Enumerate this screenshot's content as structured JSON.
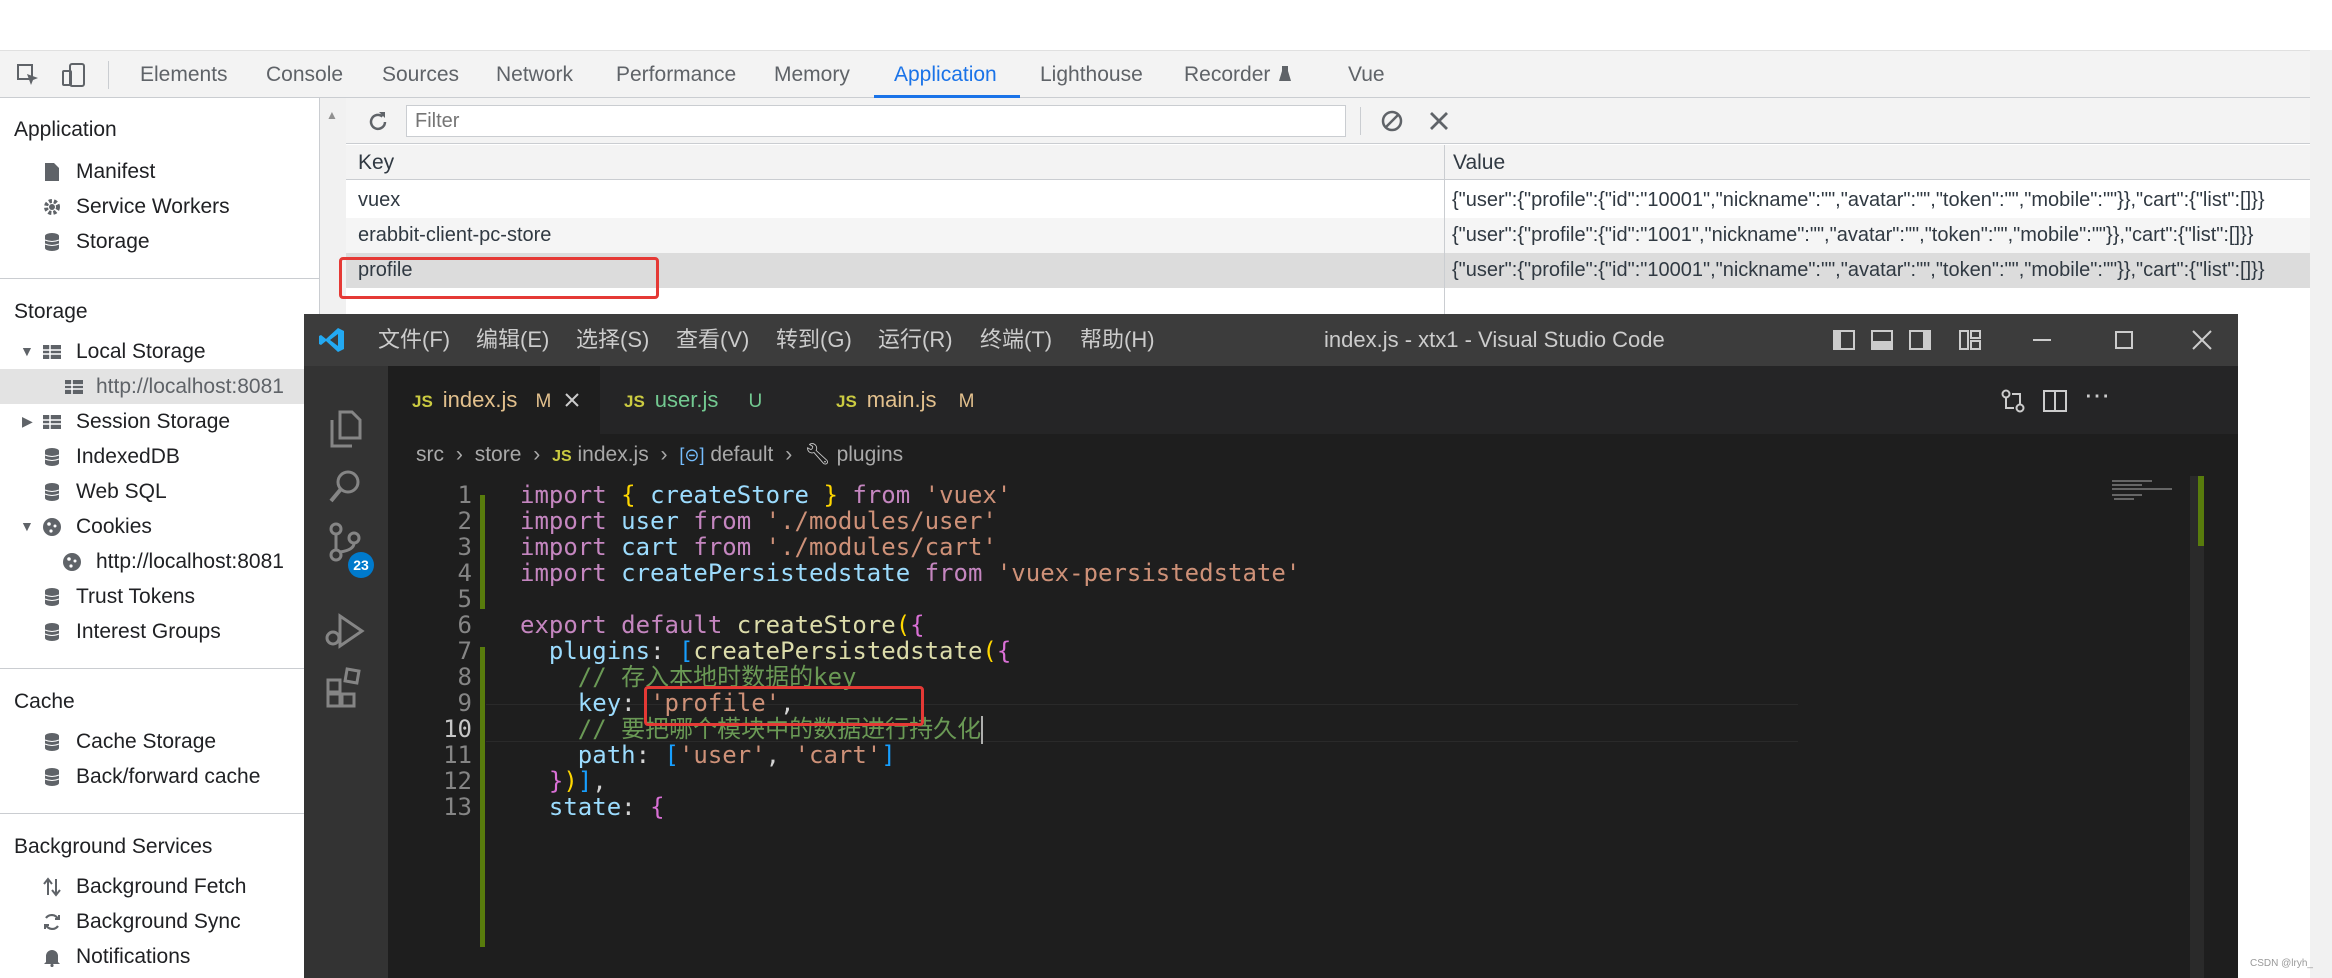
{
  "devtools": {
    "tabs": [
      "Elements",
      "Console",
      "Sources",
      "Network",
      "Performance",
      "Memory",
      "Application",
      "Lighthouse",
      "Recorder",
      "Vue"
    ],
    "active_tab": "Application",
    "sidebar": {
      "application_title": "Application",
      "application_items": [
        "Manifest",
        "Service Workers",
        "Storage"
      ],
      "storage_title": "Storage",
      "storage_items": {
        "local_storage": "Local Storage",
        "local_storage_origin": "http://localhost:8081",
        "session_storage": "Session Storage",
        "indexeddb": "IndexedDB",
        "web_sql": "Web SQL",
        "cookies": "Cookies",
        "cookies_origin": "http://localhost:8081",
        "trust_tokens": "Trust Tokens",
        "interest_groups": "Interest Groups"
      },
      "cache_title": "Cache",
      "cache_items": [
        "Cache Storage",
        "Back/forward cache"
      ],
      "bg_title": "Background Services",
      "bg_items": [
        "Background Fetch",
        "Background Sync",
        "Notifications"
      ]
    },
    "filter_placeholder": "Filter",
    "table": {
      "headers": {
        "key": "Key",
        "value": "Value"
      },
      "rows": [
        {
          "key": "vuex",
          "value": "{\"user\":{\"profile\":{\"id\":\"10001\",\"nickname\":\"\",\"avatar\":\"\",\"token\":\"\",\"mobile\":\"\"}},\"cart\":{\"list\":[]}}"
        },
        {
          "key": "erabbit-client-pc-store",
          "value": "{\"user\":{\"profile\":{\"id\":\"1001\",\"nickname\":\"\",\"avatar\":\"\",\"token\":\"\",\"mobile\":\"\"}},\"cart\":{\"list\":[]}}"
        },
        {
          "key": "profile",
          "value": "{\"user\":{\"profile\":{\"id\":\"10001\",\"nickname\":\"\",\"avatar\":\"\",\"token\":\"\",\"mobile\":\"\"}},\"cart\":{\"list\":[]}}"
        }
      ]
    }
  },
  "vscode": {
    "menus": [
      "文件(F)",
      "编辑(E)",
      "选择(S)",
      "查看(V)",
      "转到(G)",
      "运行(R)",
      "终端(T)",
      "帮助(H)"
    ],
    "window_title": "index.js - xtx1 - Visual Studio Code",
    "scm_badge": "23",
    "tabs": [
      {
        "name": "index.js",
        "status": "M"
      },
      {
        "name": "user.js",
        "status": "U"
      },
      {
        "name": "main.js",
        "status": "M"
      }
    ],
    "file_badge": "JS",
    "breadcrumb": [
      "src",
      "store",
      "index.js",
      "default",
      "plugins"
    ],
    "line_numbers": [
      "1",
      "2",
      "3",
      "4",
      "5",
      "6",
      "7",
      "8",
      "9",
      "10",
      "11",
      "12",
      "13"
    ],
    "code": {
      "l1": [
        "import",
        "{",
        "createStore",
        "}",
        "from",
        "'vuex'"
      ],
      "l2": [
        "import",
        "user",
        "from",
        "'./modules/user'"
      ],
      "l3": [
        "import",
        "cart",
        "from",
        "'./modules/cart'"
      ],
      "l4": [
        "import",
        "createPersistedstate",
        "from",
        "'vuex-persistedstate'"
      ],
      "l6": [
        "export",
        "default",
        "createStore",
        "(",
        "{"
      ],
      "l7": [
        "plugins",
        ":",
        "[",
        "createPersistedstate",
        "(",
        "{"
      ],
      "l8": "// 存入本地时数据的key",
      "l9": [
        "key",
        ":",
        "'profile'",
        ","
      ],
      "l10": "// 要把哪个模块中的数据进行持久化",
      "l11": [
        "path",
        ":",
        "[",
        "'user'",
        ",",
        "'cart'",
        "]"
      ],
      "l12": [
        "}",
        ")",
        "]",
        ","
      ],
      "l13": [
        "state",
        ":",
        "{"
      ]
    },
    "watermark": "CSDN @lryh_"
  }
}
